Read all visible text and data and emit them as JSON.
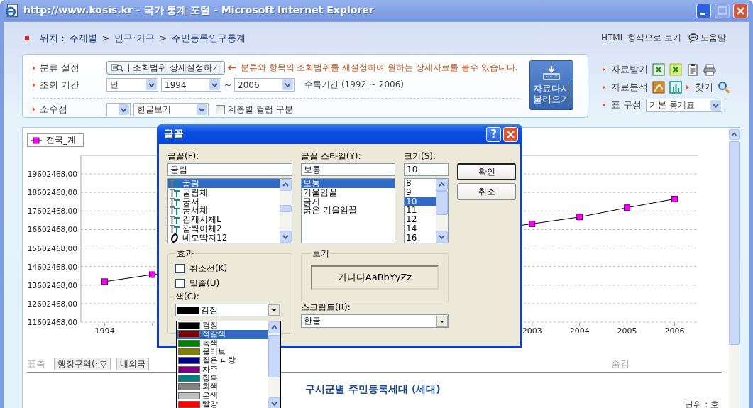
{
  "window": {
    "title": "http://www.kosis.kr - 국가 통계 포털 - Microsoft Internet Explorer"
  },
  "breadcrumb": {
    "label": "위치 :",
    "path": [
      {
        "text": "주제별",
        "kind": "link"
      },
      {
        "text": ">",
        "kind": "separator"
      },
      {
        "text": "인구·가구",
        "kind": "link"
      },
      {
        "text": ">",
        "kind": "separator"
      },
      {
        "text": "주민등록인구통계",
        "kind": "link"
      }
    ]
  },
  "header_links": {
    "html_view": "HTML 형식으로 보기",
    "help": "도움말"
  },
  "filter_panel": {
    "classification": {
      "label": "분류 설정",
      "button": "조회범위 상세설정하기",
      "hint": "분류와 항목의 조회범위를 재설정하여 원하는 상세자료를 볼수 있습니다."
    },
    "period": {
      "label": "조회 기간",
      "unit": "년",
      "from": "1994",
      "separator": "~",
      "to": "2006",
      "range_note": "수록기간 (1992 ~ 2006)"
    },
    "decimal": {
      "label": "소수점",
      "display": "한글보기",
      "layer_columns": {
        "label": "계층별 컬럼 구분",
        "checked": false
      }
    },
    "reload_button": "자료다시 불러오기"
  },
  "tools": {
    "download_label": "자료받기",
    "analysis_label": "자료분석",
    "find_label": "찾기",
    "layout_label": "표 구성",
    "layout_value": "기본 통계표"
  },
  "chart_panel": {
    "chart_data": {
      "type": "line",
      "x": [
        1994,
        1995,
        1996,
        1997,
        1998,
        1999,
        2000,
        2001,
        2002,
        2003,
        2004,
        2005,
        2006
      ],
      "grid": true,
      "series": [
        {
          "name": "전국_계",
          "color": "#ff00ff",
          "marker": "square",
          "values": [
            13790000,
            14170000,
            null,
            null,
            null,
            null,
            null,
            null,
            null,
            16910000,
            17280000,
            17780000,
            18250000
          ]
        }
      ],
      "xlim": [
        1993.5,
        2006.5
      ],
      "ylim": [
        11602468,
        20602468
      ],
      "xticks": [
        1994,
        2003,
        2004,
        2005,
        2006
      ],
      "yticks": [
        {
          "value": 11602468,
          "label": "11602468,00"
        },
        {
          "value": 12602468,
          "label": "12602468,00"
        },
        {
          "value": 13602468,
          "label": "13602468,00"
        },
        {
          "value": 14602468,
          "label": "14602468,00"
        },
        {
          "value": 15602468,
          "label": "15602468,00"
        },
        {
          "value": 16602468,
          "label": "16602468,00"
        },
        {
          "value": 17602468,
          "label": "17602468,00"
        },
        {
          "value": 18602468,
          "label": "18602468,00"
        },
        {
          "value": 19602468,
          "label": "19602468,00"
        }
      ]
    },
    "row_axis": {
      "label": "표측",
      "buttons": [
        "행정구역(··▽",
        "내외국"
      ]
    },
    "hidden_label": "숨김",
    "table_title": "구시군별 주민등록세대 (세대)",
    "unit": "단위 : 호"
  },
  "font_dialog": {
    "title": "글꼴",
    "help_button": "?",
    "font": {
      "label": "글꼴(F):",
      "value": "굴림",
      "items": [
        {
          "name": "굴림",
          "kind": "truetype",
          "selected": true
        },
        {
          "name": "굴림체",
          "kind": "truetype",
          "selected": false
        },
        {
          "name": "궁서",
          "kind": "truetype",
          "selected": false
        },
        {
          "name": "궁서체",
          "kind": "truetype",
          "selected": false
        },
        {
          "name": "김제시체L",
          "kind": "truetype",
          "selected": false
        },
        {
          "name": "깜찍이체2",
          "kind": "truetype",
          "selected": false
        },
        {
          "name": "네모딱지12",
          "kind": "opentype",
          "selected": false
        }
      ]
    },
    "style": {
      "label": "글꼴 스타일(Y):",
      "value": "보통",
      "items": [
        {
          "name": "보통",
          "selected": true
        },
        {
          "name": "기울임꼴",
          "selected": false
        },
        {
          "name": "굵게",
          "selected": false
        },
        {
          "name": "굵은 기울임꼴",
          "selected": false
        }
      ]
    },
    "size": {
      "label": "크기(S):",
      "value": "10",
      "items": [
        {
          "name": "8",
          "selected": false
        },
        {
          "name": "9",
          "selected": false
        },
        {
          "name": "10",
          "selected": true
        },
        {
          "name": "11",
          "selected": false
        },
        {
          "name": "12",
          "selected": false
        },
        {
          "name": "14",
          "selected": false
        },
        {
          "name": "16",
          "selected": false
        }
      ]
    },
    "buttons": [
      {
        "label": "확인",
        "default": true
      },
      {
        "label": "취소",
        "default": false
      }
    ],
    "effects": {
      "title": "효과",
      "strikeout": {
        "label": "취소선(K)",
        "checked": false
      },
      "underline": {
        "label": "밑줄(U)",
        "checked": false
      },
      "color_label": "색(C):",
      "color_select": {
        "value": "검정",
        "color": "#000000"
      }
    },
    "color_options": [
      {
        "name": "검정",
        "color": "#000000",
        "selected": false
      },
      {
        "name": "적갈색",
        "color": "#800000",
        "selected": true
      },
      {
        "name": "녹색",
        "color": "#008000",
        "selected": false
      },
      {
        "name": "올리브",
        "color": "#808000",
        "selected": false
      },
      {
        "name": "짙은 파랑",
        "color": "#000080",
        "selected": false
      },
      {
        "name": "자주",
        "color": "#800080",
        "selected": false
      },
      {
        "name": "청록",
        "color": "#008080",
        "selected": false
      },
      {
        "name": "회색",
        "color": "#808080",
        "selected": false
      },
      {
        "name": "은색",
        "color": "#c0c0c0",
        "selected": false
      },
      {
        "name": "빨강",
        "color": "#ff0000",
        "selected": false
      }
    ],
    "preview": {
      "title": "보기",
      "sample": "가나다AaBbYyZz"
    },
    "script": {
      "label": "스크립트(R):",
      "value": "한글"
    }
  }
}
